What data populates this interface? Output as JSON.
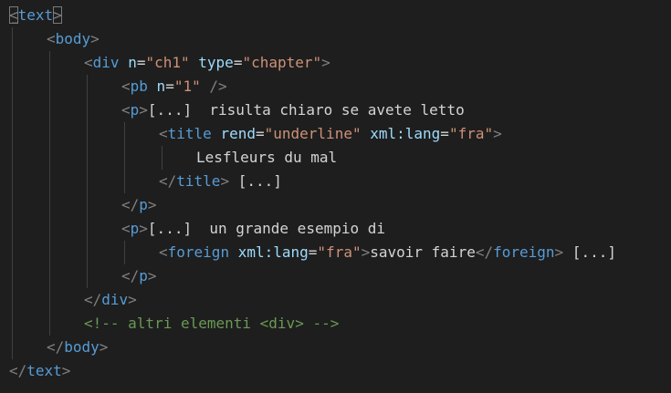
{
  "colors": {
    "background": "#1e1e1e",
    "tag": "#569cd6",
    "punctuation": "#808080",
    "attribute": "#9cdcfe",
    "string": "#ce9178",
    "text": "#d4d4d4",
    "comment": "#6a9955"
  },
  "code_lines": [
    {
      "indent": 0,
      "guides": [],
      "tokens": [
        {
          "kind": "punct",
          "text": "<",
          "box": true
        },
        {
          "kind": "tag",
          "text": "text"
        },
        {
          "kind": "punct",
          "text": ">",
          "box": true
        }
      ]
    },
    {
      "indent": 1,
      "guides": [
        0
      ],
      "tokens": [
        {
          "kind": "punct",
          "text": "<"
        },
        {
          "kind": "tag",
          "text": "body"
        },
        {
          "kind": "punct",
          "text": ">"
        }
      ]
    },
    {
      "indent": 2,
      "guides": [
        0,
        1
      ],
      "tokens": [
        {
          "kind": "punct",
          "text": "<"
        },
        {
          "kind": "tag",
          "text": "div"
        },
        {
          "kind": "text",
          "text": " "
        },
        {
          "kind": "attr",
          "text": "n"
        },
        {
          "kind": "text",
          "text": "="
        },
        {
          "kind": "str",
          "text": "\"ch1\""
        },
        {
          "kind": "text",
          "text": " "
        },
        {
          "kind": "attr",
          "text": "type"
        },
        {
          "kind": "text",
          "text": "="
        },
        {
          "kind": "str",
          "text": "\"chapter\""
        },
        {
          "kind": "punct",
          "text": ">"
        }
      ]
    },
    {
      "indent": 3,
      "guides": [
        0,
        1,
        2
      ],
      "tokens": [
        {
          "kind": "punct",
          "text": "<"
        },
        {
          "kind": "tag",
          "text": "pb"
        },
        {
          "kind": "text",
          "text": " "
        },
        {
          "kind": "attr",
          "text": "n"
        },
        {
          "kind": "text",
          "text": "="
        },
        {
          "kind": "str",
          "text": "\"1\""
        },
        {
          "kind": "text",
          "text": " "
        },
        {
          "kind": "punct",
          "text": "/>"
        }
      ]
    },
    {
      "indent": 3,
      "guides": [
        0,
        1,
        2
      ],
      "tokens": [
        {
          "kind": "punct",
          "text": "<"
        },
        {
          "kind": "tag",
          "text": "p"
        },
        {
          "kind": "punct",
          "text": ">"
        },
        {
          "kind": "text",
          "text": "[...]  risulta chiaro se avete letto"
        }
      ]
    },
    {
      "indent": 4,
      "guides": [
        0,
        1,
        2,
        3
      ],
      "tokens": [
        {
          "kind": "punct",
          "text": "<"
        },
        {
          "kind": "tag",
          "text": "title"
        },
        {
          "kind": "text",
          "text": " "
        },
        {
          "kind": "attr",
          "text": "rend"
        },
        {
          "kind": "text",
          "text": "="
        },
        {
          "kind": "str",
          "text": "\"underline\""
        },
        {
          "kind": "text",
          "text": " "
        },
        {
          "kind": "attr",
          "text": "xml:lang"
        },
        {
          "kind": "text",
          "text": "="
        },
        {
          "kind": "str",
          "text": "\"fra\""
        },
        {
          "kind": "punct",
          "text": ">"
        }
      ]
    },
    {
      "indent": 5,
      "guides": [
        0,
        1,
        2,
        3,
        4
      ],
      "tokens": [
        {
          "kind": "text",
          "text": "Lesfleurs du mal"
        }
      ]
    },
    {
      "indent": 4,
      "guides": [
        0,
        1,
        2,
        3
      ],
      "tokens": [
        {
          "kind": "punct",
          "text": "</"
        },
        {
          "kind": "tag",
          "text": "title"
        },
        {
          "kind": "punct",
          "text": ">"
        },
        {
          "kind": "text",
          "text": " [...]"
        }
      ]
    },
    {
      "indent": 3,
      "guides": [
        0,
        1,
        2
      ],
      "tokens": [
        {
          "kind": "punct",
          "text": "</"
        },
        {
          "kind": "tag",
          "text": "p"
        },
        {
          "kind": "punct",
          "text": ">"
        }
      ]
    },
    {
      "indent": 3,
      "guides": [
        0,
        1,
        2
      ],
      "tokens": [
        {
          "kind": "punct",
          "text": "<"
        },
        {
          "kind": "tag",
          "text": "p"
        },
        {
          "kind": "punct",
          "text": ">"
        },
        {
          "kind": "text",
          "text": "[...]  un grande esempio di"
        }
      ]
    },
    {
      "indent": 4,
      "guides": [
        0,
        1,
        2,
        3
      ],
      "tokens": [
        {
          "kind": "punct",
          "text": "<"
        },
        {
          "kind": "tag",
          "text": "foreign"
        },
        {
          "kind": "text",
          "text": " "
        },
        {
          "kind": "attr",
          "text": "xml:lang"
        },
        {
          "kind": "text",
          "text": "="
        },
        {
          "kind": "str",
          "text": "\"fra\""
        },
        {
          "kind": "punct",
          "text": ">"
        },
        {
          "kind": "text",
          "text": "savoir faire"
        },
        {
          "kind": "punct",
          "text": "</"
        },
        {
          "kind": "tag",
          "text": "foreign"
        },
        {
          "kind": "punct",
          "text": ">"
        },
        {
          "kind": "text",
          "text": " [...]"
        }
      ]
    },
    {
      "indent": 3,
      "guides": [
        0,
        1,
        2
      ],
      "tokens": [
        {
          "kind": "punct",
          "text": "</"
        },
        {
          "kind": "tag",
          "text": "p"
        },
        {
          "kind": "punct",
          "text": ">"
        }
      ]
    },
    {
      "indent": 2,
      "guides": [
        0,
        1
      ],
      "tokens": [
        {
          "kind": "punct",
          "text": "</"
        },
        {
          "kind": "tag",
          "text": "div"
        },
        {
          "kind": "punct",
          "text": ">"
        }
      ]
    },
    {
      "indent": 2,
      "guides": [
        0,
        1
      ],
      "tokens": [
        {
          "kind": "comment",
          "text": "<!-- altri elementi <div> -->"
        }
      ]
    },
    {
      "indent": 1,
      "guides": [
        0
      ],
      "tokens": [
        {
          "kind": "punct",
          "text": "</"
        },
        {
          "kind": "tag",
          "text": "body"
        },
        {
          "kind": "punct",
          "text": ">"
        }
      ]
    },
    {
      "indent": 0,
      "guides": [],
      "tokens": [
        {
          "kind": "punct",
          "text": "</"
        },
        {
          "kind": "tag",
          "text": "text"
        },
        {
          "kind": "punct",
          "text": ">"
        }
      ]
    }
  ]
}
